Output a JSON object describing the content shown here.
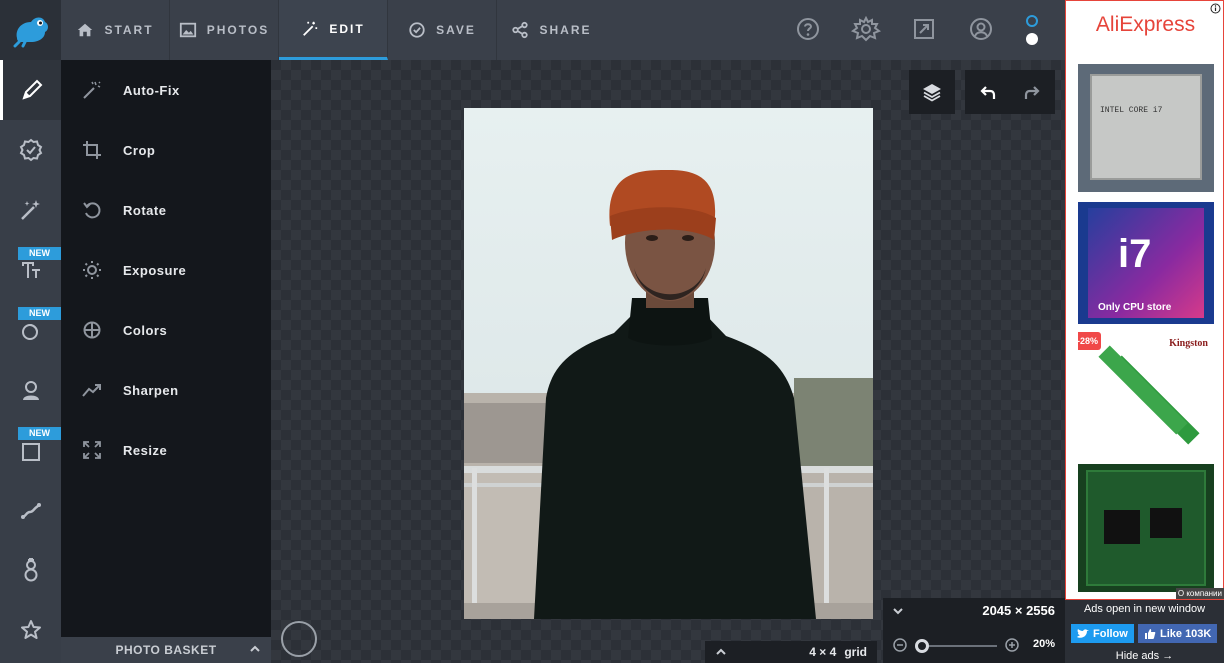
{
  "tabs": [
    {
      "label": "START",
      "icon": "home-icon"
    },
    {
      "label": "PHOTOS",
      "icon": "image-icon"
    },
    {
      "label": "EDIT",
      "icon": "magic-wand-icon"
    },
    {
      "label": "SAVE",
      "icon": "check-circle-icon"
    },
    {
      "label": "SHARE",
      "icon": "share-icon"
    }
  ],
  "rail": {
    "badge": "NEW"
  },
  "tools": [
    {
      "label": "Auto-Fix",
      "icon": "auto-fix-icon"
    },
    {
      "label": "Crop",
      "icon": "crop-icon"
    },
    {
      "label": "Rotate",
      "icon": "rotate-icon"
    },
    {
      "label": "Exposure",
      "icon": "sun-icon"
    },
    {
      "label": "Colors",
      "icon": "crosshair-icon"
    },
    {
      "label": "Sharpen",
      "icon": "trend-icon"
    },
    {
      "label": "Resize",
      "icon": "resize-icon"
    }
  ],
  "basket": {
    "label": "PHOTO BASKET"
  },
  "grid": {
    "value": "4 × 4",
    "label": "grid"
  },
  "image": {
    "dimensions": "2045 × 2556",
    "zoom": "20%",
    "zoom_fraction": 0.05
  },
  "ad": {
    "brand": "AliExpress",
    "discount": "-28%",
    "cpu_text": "INTEL CORE i7",
    "box_text": "Only CPU store",
    "ram_brand": "Kingston",
    "corner_label": "О компании",
    "open_note": "Ads open in new window",
    "follow_label": "Follow",
    "like_label": "Like 103K",
    "hide_label": "Hide ads →"
  },
  "colors": {
    "accent": "#2d9cdb",
    "ad_brand": "#e6443a",
    "panel": "#14171c"
  }
}
